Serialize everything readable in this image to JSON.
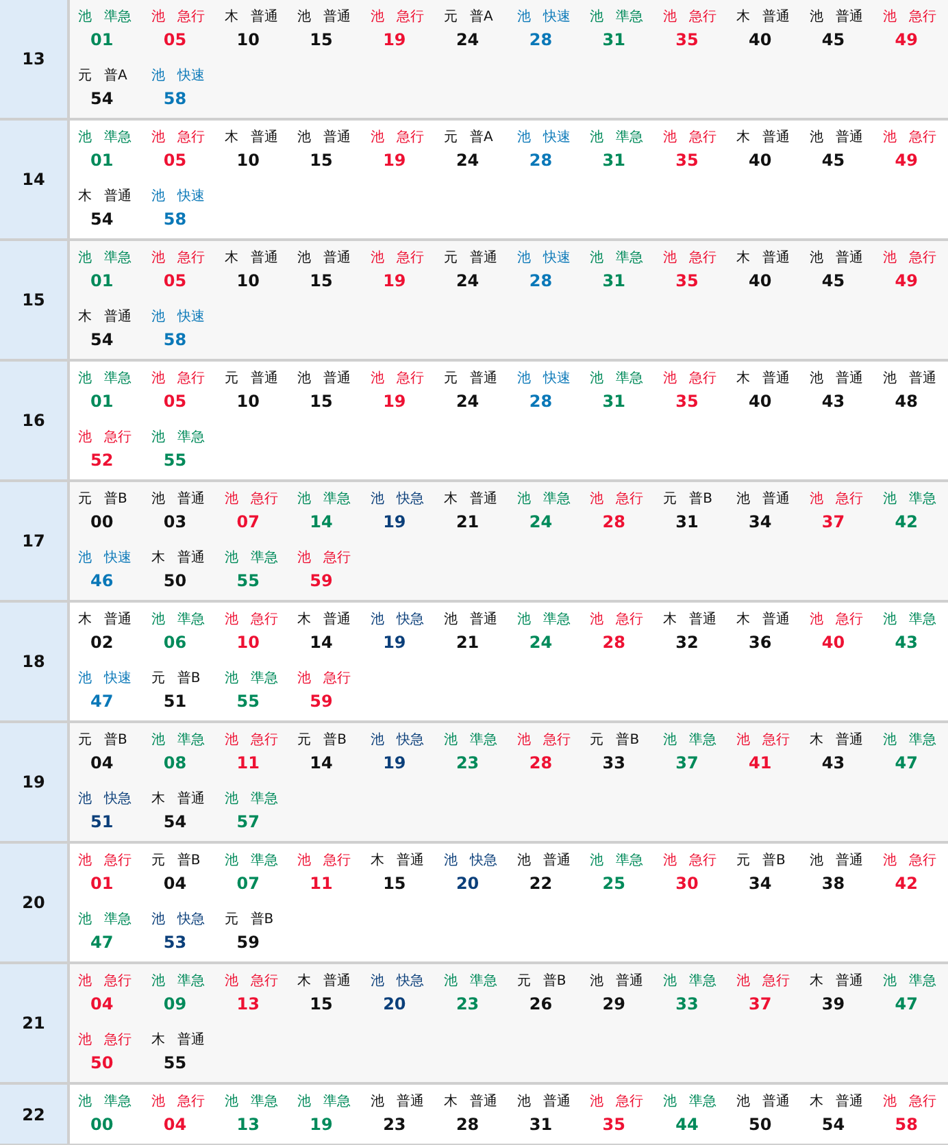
{
  "hours": [
    {
      "hour": "13",
      "trains": [
        {
          "dest": "池",
          "type": "準急",
          "minute": "01",
          "kind": "semi"
        },
        {
          "dest": "池",
          "type": "急行",
          "minute": "05",
          "kind": "express"
        },
        {
          "dest": "木",
          "type": "普通",
          "minute": "10",
          "kind": "local"
        },
        {
          "dest": "池",
          "type": "普通",
          "minute": "15",
          "kind": "local"
        },
        {
          "dest": "池",
          "type": "急行",
          "minute": "19",
          "kind": "express"
        },
        {
          "dest": "元",
          "type": "普A",
          "minute": "24",
          "kind": "local"
        },
        {
          "dest": "池",
          "type": "快速",
          "minute": "28",
          "kind": "rapid"
        },
        {
          "dest": "池",
          "type": "準急",
          "minute": "31",
          "kind": "semi"
        },
        {
          "dest": "池",
          "type": "急行",
          "minute": "35",
          "kind": "express"
        },
        {
          "dest": "木",
          "type": "普通",
          "minute": "40",
          "kind": "local"
        },
        {
          "dest": "池",
          "type": "普通",
          "minute": "45",
          "kind": "local"
        },
        {
          "dest": "池",
          "type": "急行",
          "minute": "49",
          "kind": "express"
        },
        {
          "dest": "元",
          "type": "普A",
          "minute": "54",
          "kind": "local"
        },
        {
          "dest": "池",
          "type": "快速",
          "minute": "58",
          "kind": "rapid"
        }
      ]
    },
    {
      "hour": "14",
      "trains": [
        {
          "dest": "池",
          "type": "準急",
          "minute": "01",
          "kind": "semi"
        },
        {
          "dest": "池",
          "type": "急行",
          "minute": "05",
          "kind": "express"
        },
        {
          "dest": "木",
          "type": "普通",
          "minute": "10",
          "kind": "local"
        },
        {
          "dest": "池",
          "type": "普通",
          "minute": "15",
          "kind": "local"
        },
        {
          "dest": "池",
          "type": "急行",
          "minute": "19",
          "kind": "express"
        },
        {
          "dest": "元",
          "type": "普A",
          "minute": "24",
          "kind": "local"
        },
        {
          "dest": "池",
          "type": "快速",
          "minute": "28",
          "kind": "rapid"
        },
        {
          "dest": "池",
          "type": "準急",
          "minute": "31",
          "kind": "semi"
        },
        {
          "dest": "池",
          "type": "急行",
          "minute": "35",
          "kind": "express"
        },
        {
          "dest": "木",
          "type": "普通",
          "minute": "40",
          "kind": "local"
        },
        {
          "dest": "池",
          "type": "普通",
          "minute": "45",
          "kind": "local"
        },
        {
          "dest": "池",
          "type": "急行",
          "minute": "49",
          "kind": "express"
        },
        {
          "dest": "木",
          "type": "普通",
          "minute": "54",
          "kind": "local"
        },
        {
          "dest": "池",
          "type": "快速",
          "minute": "58",
          "kind": "rapid"
        }
      ]
    },
    {
      "hour": "15",
      "trains": [
        {
          "dest": "池",
          "type": "準急",
          "minute": "01",
          "kind": "semi"
        },
        {
          "dest": "池",
          "type": "急行",
          "minute": "05",
          "kind": "express"
        },
        {
          "dest": "木",
          "type": "普通",
          "minute": "10",
          "kind": "local"
        },
        {
          "dest": "池",
          "type": "普通",
          "minute": "15",
          "kind": "local"
        },
        {
          "dest": "池",
          "type": "急行",
          "minute": "19",
          "kind": "express"
        },
        {
          "dest": "元",
          "type": "普通",
          "minute": "24",
          "kind": "local"
        },
        {
          "dest": "池",
          "type": "快速",
          "minute": "28",
          "kind": "rapid"
        },
        {
          "dest": "池",
          "type": "準急",
          "minute": "31",
          "kind": "semi"
        },
        {
          "dest": "池",
          "type": "急行",
          "minute": "35",
          "kind": "express"
        },
        {
          "dest": "木",
          "type": "普通",
          "minute": "40",
          "kind": "local"
        },
        {
          "dest": "池",
          "type": "普通",
          "minute": "45",
          "kind": "local"
        },
        {
          "dest": "池",
          "type": "急行",
          "minute": "49",
          "kind": "express"
        },
        {
          "dest": "木",
          "type": "普通",
          "minute": "54",
          "kind": "local"
        },
        {
          "dest": "池",
          "type": "快速",
          "minute": "58",
          "kind": "rapid"
        }
      ]
    },
    {
      "hour": "16",
      "trains": [
        {
          "dest": "池",
          "type": "準急",
          "minute": "01",
          "kind": "semi"
        },
        {
          "dest": "池",
          "type": "急行",
          "minute": "05",
          "kind": "express"
        },
        {
          "dest": "元",
          "type": "普通",
          "minute": "10",
          "kind": "local"
        },
        {
          "dest": "池",
          "type": "普通",
          "minute": "15",
          "kind": "local"
        },
        {
          "dest": "池",
          "type": "急行",
          "minute": "19",
          "kind": "express"
        },
        {
          "dest": "元",
          "type": "普通",
          "minute": "24",
          "kind": "local"
        },
        {
          "dest": "池",
          "type": "快速",
          "minute": "28",
          "kind": "rapid"
        },
        {
          "dest": "池",
          "type": "準急",
          "minute": "31",
          "kind": "semi"
        },
        {
          "dest": "池",
          "type": "急行",
          "minute": "35",
          "kind": "express"
        },
        {
          "dest": "木",
          "type": "普通",
          "minute": "40",
          "kind": "local"
        },
        {
          "dest": "池",
          "type": "普通",
          "minute": "43",
          "kind": "local"
        },
        {
          "dest": "池",
          "type": "普通",
          "minute": "48",
          "kind": "local"
        },
        {
          "dest": "池",
          "type": "急行",
          "minute": "52",
          "kind": "express"
        },
        {
          "dest": "池",
          "type": "準急",
          "minute": "55",
          "kind": "semi"
        }
      ]
    },
    {
      "hour": "17",
      "trains": [
        {
          "dest": "元",
          "type": "普B",
          "minute": "00",
          "kind": "local"
        },
        {
          "dest": "池",
          "type": "普通",
          "minute": "03",
          "kind": "local"
        },
        {
          "dest": "池",
          "type": "急行",
          "minute": "07",
          "kind": "express"
        },
        {
          "dest": "池",
          "type": "準急",
          "minute": "14",
          "kind": "semi"
        },
        {
          "dest": "池",
          "type": "快急",
          "minute": "19",
          "kind": "rapid_express"
        },
        {
          "dest": "木",
          "type": "普通",
          "minute": "21",
          "kind": "local"
        },
        {
          "dest": "池",
          "type": "準急",
          "minute": "24",
          "kind": "semi"
        },
        {
          "dest": "池",
          "type": "急行",
          "minute": "28",
          "kind": "express"
        },
        {
          "dest": "元",
          "type": "普B",
          "minute": "31",
          "kind": "local"
        },
        {
          "dest": "池",
          "type": "普通",
          "minute": "34",
          "kind": "local"
        },
        {
          "dest": "池",
          "type": "急行",
          "minute": "37",
          "kind": "express"
        },
        {
          "dest": "池",
          "type": "準急",
          "minute": "42",
          "kind": "semi"
        },
        {
          "dest": "池",
          "type": "快速",
          "minute": "46",
          "kind": "rapid"
        },
        {
          "dest": "木",
          "type": "普通",
          "minute": "50",
          "kind": "local"
        },
        {
          "dest": "池",
          "type": "準急",
          "minute": "55",
          "kind": "semi"
        },
        {
          "dest": "池",
          "type": "急行",
          "minute": "59",
          "kind": "express"
        }
      ]
    },
    {
      "hour": "18",
      "trains": [
        {
          "dest": "木",
          "type": "普通",
          "minute": "02",
          "kind": "local"
        },
        {
          "dest": "池",
          "type": "準急",
          "minute": "06",
          "kind": "semi"
        },
        {
          "dest": "池",
          "type": "急行",
          "minute": "10",
          "kind": "express"
        },
        {
          "dest": "木",
          "type": "普通",
          "minute": "14",
          "kind": "local"
        },
        {
          "dest": "池",
          "type": "快急",
          "minute": "19",
          "kind": "rapid_express"
        },
        {
          "dest": "池",
          "type": "普通",
          "minute": "21",
          "kind": "local"
        },
        {
          "dest": "池",
          "type": "準急",
          "minute": "24",
          "kind": "semi"
        },
        {
          "dest": "池",
          "type": "急行",
          "minute": "28",
          "kind": "express"
        },
        {
          "dest": "木",
          "type": "普通",
          "minute": "32",
          "kind": "local"
        },
        {
          "dest": "木",
          "type": "普通",
          "minute": "36",
          "kind": "local"
        },
        {
          "dest": "池",
          "type": "急行",
          "minute": "40",
          "kind": "express"
        },
        {
          "dest": "池",
          "type": "準急",
          "minute": "43",
          "kind": "semi"
        },
        {
          "dest": "池",
          "type": "快速",
          "minute": "47",
          "kind": "rapid"
        },
        {
          "dest": "元",
          "type": "普B",
          "minute": "51",
          "kind": "local"
        },
        {
          "dest": "池",
          "type": "準急",
          "minute": "55",
          "kind": "semi"
        },
        {
          "dest": "池",
          "type": "急行",
          "minute": "59",
          "kind": "express"
        }
      ]
    },
    {
      "hour": "19",
      "trains": [
        {
          "dest": "元",
          "type": "普B",
          "minute": "04",
          "kind": "local"
        },
        {
          "dest": "池",
          "type": "準急",
          "minute": "08",
          "kind": "semi"
        },
        {
          "dest": "池",
          "type": "急行",
          "minute": "11",
          "kind": "express"
        },
        {
          "dest": "元",
          "type": "普B",
          "minute": "14",
          "kind": "local"
        },
        {
          "dest": "池",
          "type": "快急",
          "minute": "19",
          "kind": "rapid_express"
        },
        {
          "dest": "池",
          "type": "準急",
          "minute": "23",
          "kind": "semi"
        },
        {
          "dest": "池",
          "type": "急行",
          "minute": "28",
          "kind": "express"
        },
        {
          "dest": "元",
          "type": "普B",
          "minute": "33",
          "kind": "local"
        },
        {
          "dest": "池",
          "type": "準急",
          "minute": "37",
          "kind": "semi"
        },
        {
          "dest": "池",
          "type": "急行",
          "minute": "41",
          "kind": "express"
        },
        {
          "dest": "木",
          "type": "普通",
          "minute": "43",
          "kind": "local"
        },
        {
          "dest": "池",
          "type": "準急",
          "minute": "47",
          "kind": "semi"
        },
        {
          "dest": "池",
          "type": "快急",
          "minute": "51",
          "kind": "rapid_express"
        },
        {
          "dest": "木",
          "type": "普通",
          "minute": "54",
          "kind": "local"
        },
        {
          "dest": "池",
          "type": "準急",
          "minute": "57",
          "kind": "semi"
        }
      ]
    },
    {
      "hour": "20",
      "trains": [
        {
          "dest": "池",
          "type": "急行",
          "minute": "01",
          "kind": "express"
        },
        {
          "dest": "元",
          "type": "普B",
          "minute": "04",
          "kind": "local"
        },
        {
          "dest": "池",
          "type": "準急",
          "minute": "07",
          "kind": "semi"
        },
        {
          "dest": "池",
          "type": "急行",
          "minute": "11",
          "kind": "express"
        },
        {
          "dest": "木",
          "type": "普通",
          "minute": "15",
          "kind": "local"
        },
        {
          "dest": "池",
          "type": "快急",
          "minute": "20",
          "kind": "rapid_express"
        },
        {
          "dest": "池",
          "type": "普通",
          "minute": "22",
          "kind": "local"
        },
        {
          "dest": "池",
          "type": "準急",
          "minute": "25",
          "kind": "semi"
        },
        {
          "dest": "池",
          "type": "急行",
          "minute": "30",
          "kind": "express"
        },
        {
          "dest": "元",
          "type": "普B",
          "minute": "34",
          "kind": "local"
        },
        {
          "dest": "池",
          "type": "普通",
          "minute": "38",
          "kind": "local"
        },
        {
          "dest": "池",
          "type": "急行",
          "minute": "42",
          "kind": "express"
        },
        {
          "dest": "池",
          "type": "準急",
          "minute": "47",
          "kind": "semi"
        },
        {
          "dest": "池",
          "type": "快急",
          "minute": "53",
          "kind": "rapid_express"
        },
        {
          "dest": "元",
          "type": "普B",
          "minute": "59",
          "kind": "local"
        }
      ]
    },
    {
      "hour": "21",
      "trains": [
        {
          "dest": "池",
          "type": "急行",
          "minute": "04",
          "kind": "express"
        },
        {
          "dest": "池",
          "type": "準急",
          "minute": "09",
          "kind": "semi"
        },
        {
          "dest": "池",
          "type": "急行",
          "minute": "13",
          "kind": "express"
        },
        {
          "dest": "木",
          "type": "普通",
          "minute": "15",
          "kind": "local"
        },
        {
          "dest": "池",
          "type": "快急",
          "minute": "20",
          "kind": "rapid_express"
        },
        {
          "dest": "池",
          "type": "準急",
          "minute": "23",
          "kind": "semi"
        },
        {
          "dest": "元",
          "type": "普B",
          "minute": "26",
          "kind": "local"
        },
        {
          "dest": "池",
          "type": "普通",
          "minute": "29",
          "kind": "local"
        },
        {
          "dest": "池",
          "type": "準急",
          "minute": "33",
          "kind": "semi"
        },
        {
          "dest": "池",
          "type": "急行",
          "minute": "37",
          "kind": "express"
        },
        {
          "dest": "木",
          "type": "普通",
          "minute": "39",
          "kind": "local"
        },
        {
          "dest": "池",
          "type": "準急",
          "minute": "47",
          "kind": "semi"
        },
        {
          "dest": "池",
          "type": "急行",
          "minute": "50",
          "kind": "express"
        },
        {
          "dest": "木",
          "type": "普通",
          "minute": "55",
          "kind": "local"
        }
      ]
    },
    {
      "hour": "22",
      "trains": [
        {
          "dest": "池",
          "type": "準急",
          "minute": "00",
          "kind": "semi"
        },
        {
          "dest": "池",
          "type": "急行",
          "minute": "04",
          "kind": "express"
        },
        {
          "dest": "池",
          "type": "準急",
          "minute": "13",
          "kind": "semi"
        },
        {
          "dest": "池",
          "type": "準急",
          "minute": "19",
          "kind": "semi"
        },
        {
          "dest": "池",
          "type": "普通",
          "minute": "23",
          "kind": "local"
        },
        {
          "dest": "木",
          "type": "普通",
          "minute": "28",
          "kind": "local"
        },
        {
          "dest": "池",
          "type": "普通",
          "minute": "31",
          "kind": "local"
        },
        {
          "dest": "池",
          "type": "急行",
          "minute": "35",
          "kind": "express"
        },
        {
          "dest": "池",
          "type": "準急",
          "minute": "44",
          "kind": "semi"
        },
        {
          "dest": "池",
          "type": "普通",
          "minute": "50",
          "kind": "local"
        },
        {
          "dest": "木",
          "type": "普通",
          "minute": "54",
          "kind": "local"
        },
        {
          "dest": "池",
          "type": "急行",
          "minute": "58",
          "kind": "express"
        }
      ]
    }
  ]
}
